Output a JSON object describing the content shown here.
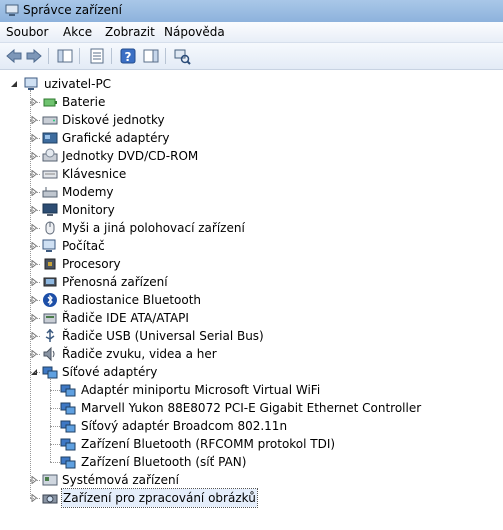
{
  "window": {
    "title": "Správce zařízení"
  },
  "menu": {
    "items": [
      "Soubor",
      "Akce",
      "Zobrazit",
      "Nápověda"
    ]
  },
  "toolbar": {
    "buttons": [
      "back-icon",
      "forward-icon",
      "show-hide-console-tree-icon",
      "properties-icon",
      "help-icon",
      "action-pane-icon",
      "scan-hardware-icon"
    ]
  },
  "tree": {
    "root": "uzivatel-PC",
    "categories": [
      {
        "label": "Baterie",
        "icon": "battery-icon"
      },
      {
        "label": "Diskové jednotky",
        "icon": "disk-drive-icon"
      },
      {
        "label": "Grafické adaptéry",
        "icon": "display-adapter-icon"
      },
      {
        "label": "Jednotky DVD/CD-ROM",
        "icon": "dvd-drive-icon"
      },
      {
        "label": "Klávesnice",
        "icon": "keyboard-icon"
      },
      {
        "label": "Modemy",
        "icon": "modem-icon"
      },
      {
        "label": "Monitory",
        "icon": "monitor-icon"
      },
      {
        "label": "Myši a jiná polohovací zařízení",
        "icon": "mouse-icon"
      },
      {
        "label": "Počítač",
        "icon": "computer-icon"
      },
      {
        "label": "Procesory",
        "icon": "processor-icon"
      },
      {
        "label": "Přenosná zařízení",
        "icon": "portable-device-icon"
      },
      {
        "label": "Radiostanice Bluetooth",
        "icon": "bluetooth-icon"
      },
      {
        "label": "Řadiče IDE ATA/ATAPI",
        "icon": "ide-controller-icon"
      },
      {
        "label": "Řadiče USB (Universal Serial Bus)",
        "icon": "usb-controller-icon"
      },
      {
        "label": "Řadiče zvuku, videa a her",
        "icon": "sound-icon"
      },
      {
        "label": "Síťové adaptéry",
        "icon": "network-adapter-icon",
        "expanded": true,
        "children": [
          "Adaptér miniportu Microsoft Virtual WiFi",
          "Marvell Yukon 88E8072 PCI-E Gigabit Ethernet Controller",
          "Síťový adaptér Broadcom 802.11n",
          "Zařízení Bluetooth (RFCOMM protokol TDI)",
          "Zařízení Bluetooth (síť PAN)"
        ]
      },
      {
        "label": "Systémová zařízení",
        "icon": "system-device-icon"
      },
      {
        "label": "Zařízení pro zpracování obrázků",
        "icon": "imaging-device-icon",
        "selected": true
      }
    ]
  }
}
